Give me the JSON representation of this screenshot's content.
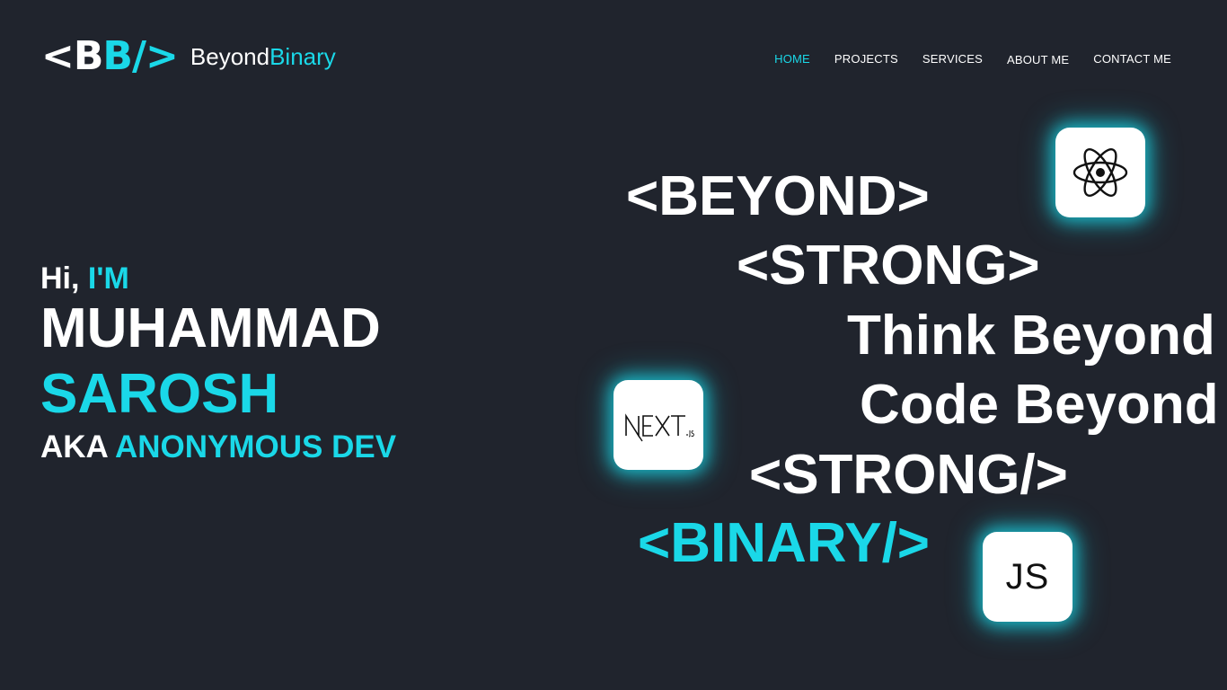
{
  "brand": {
    "mark_left": "<B",
    "mark_right": "B/>",
    "name_white": "Beyond",
    "name_cyan": "Binary"
  },
  "nav": {
    "items": [
      {
        "label": "HOME",
        "active": true
      },
      {
        "label": "PROJECTS",
        "active": false
      },
      {
        "label": "SERVICES",
        "active": false
      },
      {
        "label": "ABOUT ME",
        "active": false
      },
      {
        "label": "CONTACT ME",
        "active": false
      }
    ]
  },
  "intro": {
    "hi": "Hi,",
    "im": "I'M",
    "first_name": "MUHAMMAD",
    "last_name": "SAROSH",
    "aka": "AKA",
    "alias": "ANONYMOUS DEV"
  },
  "code_lines": {
    "beyond_open": "<BEYOND>",
    "strong_open": "<STRONG>",
    "think": "Think Beyond",
    "code": "Code Beyond",
    "strong_close": "<STRONG/>",
    "binary_close": "<BINARY/>"
  },
  "tech_icons": {
    "react": "react-icon",
    "next": "nextjs-icon",
    "js_label": "JS"
  },
  "colors": {
    "background": "#20242d",
    "accent": "#1ad8e8",
    "text": "#ffffff"
  }
}
